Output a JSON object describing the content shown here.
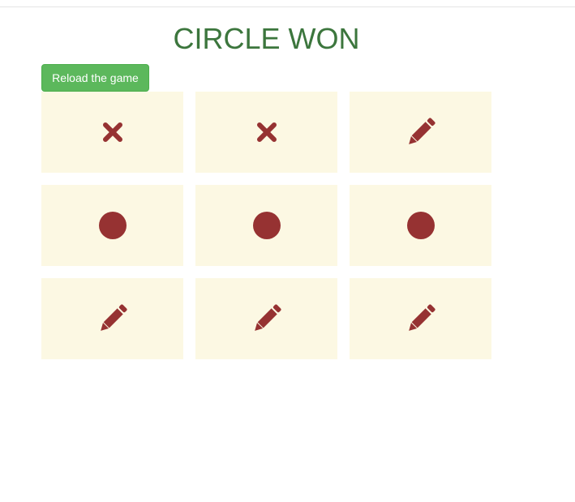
{
  "header": {
    "title": "CIRCLE WON"
  },
  "controls": {
    "reload_label": "Reload the game"
  },
  "colors": {
    "title": "#3c763d",
    "button": "#5cb85c",
    "cell_background": "#fcf8e3",
    "mark": "#963232"
  },
  "board": {
    "cells": [
      {
        "mark": "cross",
        "icon": "cross-icon"
      },
      {
        "mark": "cross",
        "icon": "cross-icon"
      },
      {
        "mark": "empty",
        "icon": "pencil-icon"
      },
      {
        "mark": "circle",
        "icon": "circle-icon"
      },
      {
        "mark": "circle",
        "icon": "circle-icon"
      },
      {
        "mark": "circle",
        "icon": "circle-icon"
      },
      {
        "mark": "empty",
        "icon": "pencil-icon"
      },
      {
        "mark": "empty",
        "icon": "pencil-icon"
      },
      {
        "mark": "empty",
        "icon": "pencil-icon"
      }
    ]
  }
}
